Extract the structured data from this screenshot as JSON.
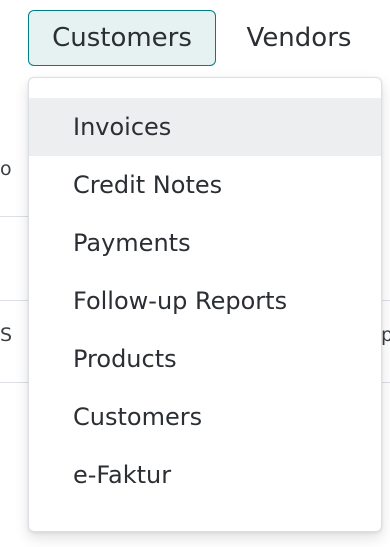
{
  "navbar": {
    "customers_label": "Customers",
    "vendors_label": "Vendors"
  },
  "dropdown": {
    "items": [
      {
        "label": "Invoices",
        "highlighted": true
      },
      {
        "label": "Credit Notes",
        "highlighted": false
      },
      {
        "label": "Payments",
        "highlighted": false
      },
      {
        "label": "Follow-up Reports",
        "highlighted": false
      },
      {
        "label": "Products",
        "highlighted": false
      },
      {
        "label": "Customers",
        "highlighted": false
      },
      {
        "label": "e-Faktur",
        "highlighted": false
      }
    ]
  },
  "background": {
    "frag_o": "o",
    "frag_s": "S",
    "frag_p": "p"
  },
  "colors": {
    "accent": "#017e84",
    "active_bg": "#e6f2f2",
    "highlight_bg": "#eceef0"
  }
}
